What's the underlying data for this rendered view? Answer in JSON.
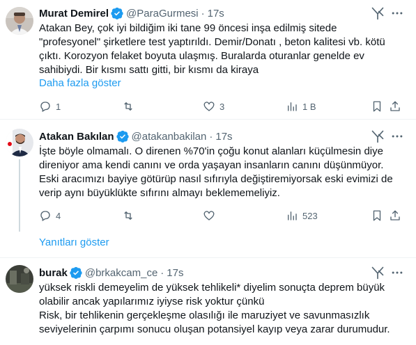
{
  "tweets": [
    {
      "name": "Murat Demirel",
      "handle": "@ParaGurmesi",
      "separator": "·",
      "time": "17s",
      "lines": [
        "Atakan Bey, çok iyi bildiğim iki tane 99 öncesi inşa edilmiş sitede",
        "\"profesyonel\" şirketlere test yaptırıldı. Demir/Donatı , beton kalitesi vb. kötü",
        "çıktı. Korozyon felaket boyuta ulaşmış. Buralarda oturanlar genelde ev",
        "sahibiydi. Bir kısmı sattı gitti, bir kısmı da kiraya"
      ],
      "show_more": "Daha fazla göster",
      "replies": "1",
      "retweets": "",
      "likes": "3",
      "views": "1 B"
    },
    {
      "name": "Atakan Bakılan",
      "handle": "@atakanbakilan",
      "separator": "·",
      "time": "17s",
      "lines": [
        "İşte böyle olmamalı. O direnen %70'in çoğu konut alanları küçülmesin diye",
        "direniyor ama kendi canını ve orda yaşayan insanların canını düşünmüyor.",
        "Eski aracımızı bayiye götürüp nasıl sıfırıyla değiştiremiyorsak eski evimizi de",
        "verip aynı büyüklükte sıfırını almayı beklememeliyiz."
      ],
      "replies": "4",
      "retweets": "",
      "likes": "",
      "views": "523",
      "show_replies": "Yanıtları göster"
    },
    {
      "name": "burak",
      "handle": "@brkakcam_ce",
      "separator": "·",
      "time": "17s",
      "lines": [
        "yüksek riskli demeyelim de yüksek tehlikeli* diyelim sonuçta deprem büyük",
        "olabilir ancak yapılarımız iyiyse risk yoktur çünkü",
        "Risk, bir tehlikenin gerçekleşme olasılığı ile maruziyet ve savunmasızlık",
        "seviyelerinin çarpımı sonucu oluşan potansiyel kayıp veya zarar durumudur."
      ]
    }
  ],
  "colors": {
    "text": "#0f1419",
    "secondary": "#536471",
    "link": "#1d9bf0",
    "verified": "#1d9bf0",
    "divider": "#eff3f4"
  }
}
